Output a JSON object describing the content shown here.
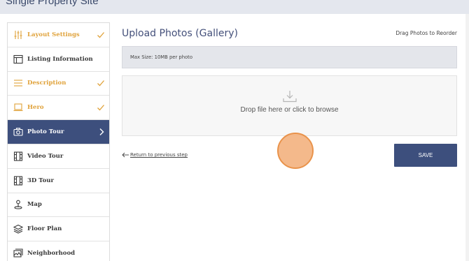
{
  "app": {
    "title": "Single Property Site"
  },
  "sidebar": {
    "items": [
      {
        "label": "Layout Settings",
        "icon": "sliders-icon",
        "status": "done"
      },
      {
        "label": "Listing Information",
        "icon": "document-icon",
        "status": "none"
      },
      {
        "label": "Description",
        "icon": "lines-icon",
        "status": "done"
      },
      {
        "label": "Hero",
        "icon": "monitor-icon",
        "status": "done"
      },
      {
        "label": "Photo Tour",
        "icon": "camera-icon",
        "status": "active"
      },
      {
        "label": "Video Tour",
        "icon": "film-icon",
        "status": "none"
      },
      {
        "label": "3D Tour",
        "icon": "film-icon",
        "status": "none"
      },
      {
        "label": "Map",
        "icon": "map-pin-icon",
        "status": "none"
      },
      {
        "label": "Floor Plan",
        "icon": "layers-icon",
        "status": "none"
      },
      {
        "label": "Neighborhood",
        "icon": "photos-icon",
        "status": "none"
      }
    ]
  },
  "main": {
    "title": "Upload Photos (Gallery)",
    "reorder_hint": "Drag Photos to Reorder",
    "max_size": "Max Size: 10MB per photo",
    "dropzone_text": "Drop file here or click to browse",
    "back_link": "Return to previous step",
    "save_label": "SAVE"
  },
  "colors": {
    "accent": "#3d4f7d",
    "done": "#e0a23a",
    "topbar": "#e4e7ee"
  }
}
